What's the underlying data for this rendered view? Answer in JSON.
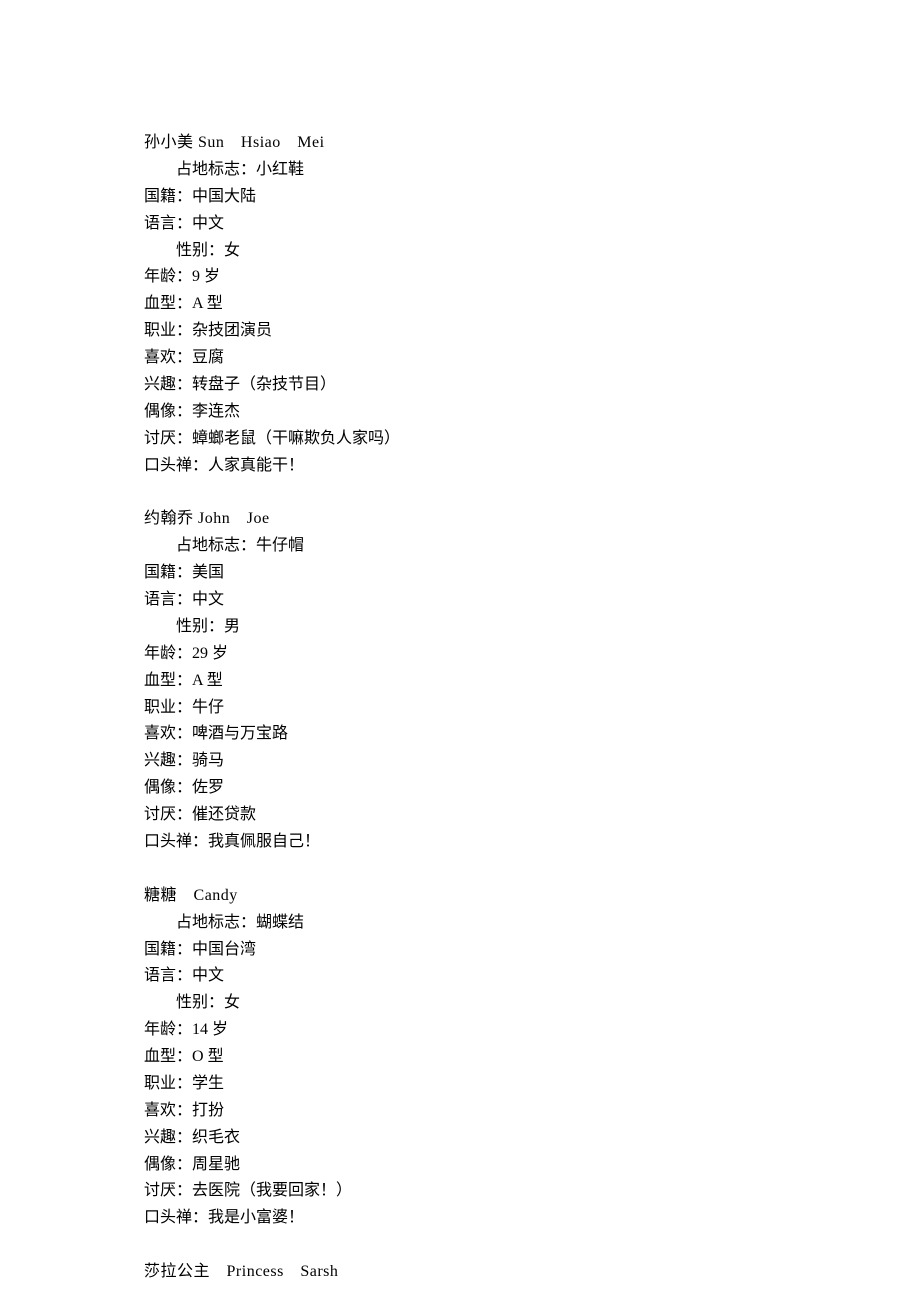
{
  "characters": [
    {
      "name": "孙小美",
      "alias": "Sun　Hsiao　Mei",
      "marker_label": "占地标志：",
      "marker": "小红鞋",
      "fields": [
        {
          "label": "国籍：",
          "value": "中国大陆",
          "indent": false
        },
        {
          "label": "语言：",
          "value": "中文",
          "indent": false
        },
        {
          "label": "性别：",
          "value": "女",
          "indent": true
        },
        {
          "label": "年龄：",
          "value": "9 岁",
          "indent": false
        },
        {
          "label": "血型：",
          "value": "A 型",
          "indent": false
        },
        {
          "label": "职业：",
          "value": "杂技团演员",
          "indent": false
        },
        {
          "label": "喜欢：",
          "value": "豆腐",
          "indent": false
        },
        {
          "label": "兴趣：",
          "value": "转盘子（杂技节目）",
          "indent": false
        },
        {
          "label": "偶像：",
          "value": "李连杰",
          "indent": false
        },
        {
          "label": "讨厌：",
          "value": "蟑螂老鼠（干嘛欺负人家吗）",
          "indent": false
        },
        {
          "label": "口头禅：",
          "value": "人家真能干！",
          "indent": false
        }
      ]
    },
    {
      "name": "约翰乔",
      "alias": "John　Joe",
      "marker_label": "占地标志：",
      "marker": "牛仔帽",
      "fields": [
        {
          "label": "国籍：",
          "value": "美国",
          "indent": false
        },
        {
          "label": "语言：",
          "value": "中文",
          "indent": false
        },
        {
          "label": "性别：",
          "value": "男",
          "indent": true
        },
        {
          "label": "年龄：",
          "value": "29 岁",
          "indent": false
        },
        {
          "label": "血型：",
          "value": "A 型",
          "indent": false
        },
        {
          "label": "职业：",
          "value": "牛仔",
          "indent": false
        },
        {
          "label": "喜欢：",
          "value": "啤酒与万宝路",
          "indent": false
        },
        {
          "label": "兴趣：",
          "value": "骑马",
          "indent": false
        },
        {
          "label": "偶像：",
          "value": "佐罗",
          "indent": false
        },
        {
          "label": "讨厌：",
          "value": "催还贷款",
          "indent": false
        },
        {
          "label": "口头禅：",
          "value": "我真佩服自己！",
          "indent": false
        }
      ]
    },
    {
      "name": "糖糖",
      "alias": "　Candy",
      "marker_label": "占地标志：",
      "marker": "蝴蝶结",
      "fields": [
        {
          "label": "国籍：",
          "value": "中国台湾",
          "indent": false
        },
        {
          "label": "语言：",
          "value": "中文",
          "indent": false
        },
        {
          "label": "性别：",
          "value": "女",
          "indent": true
        },
        {
          "label": "年龄：",
          "value": "14 岁",
          "indent": false
        },
        {
          "label": "血型：",
          "value": "O 型",
          "indent": false
        },
        {
          "label": "职业：",
          "value": "学生",
          "indent": false
        },
        {
          "label": "喜欢：",
          "value": "打扮",
          "indent": false
        },
        {
          "label": "兴趣：",
          "value": "织毛衣",
          "indent": false
        },
        {
          "label": "偶像：",
          "value": "周星驰",
          "indent": false
        },
        {
          "label": "讨厌：",
          "value": "去医院（我要回家！）",
          "indent": false
        },
        {
          "label": "口头禅：",
          "value": "我是小富婆！",
          "indent": false
        }
      ]
    }
  ],
  "trailing": {
    "name": "莎拉公主",
    "alias": "　Princess　Sarsh"
  }
}
